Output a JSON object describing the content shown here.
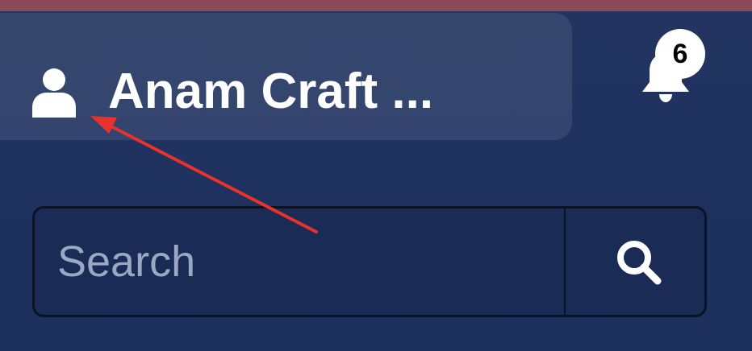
{
  "header": {
    "account_name": "Anam Craft ...",
    "user_icon": "user-icon",
    "notifications": {
      "icon": "bell-icon",
      "count": "6"
    }
  },
  "search": {
    "placeholder": "Search",
    "value": "",
    "icon": "search-icon"
  },
  "colors": {
    "background": "#1f3260",
    "card": "#2d4170",
    "top_strip": "#8a4a5a",
    "text": "#ffffff",
    "annotation": "#e8322c"
  }
}
